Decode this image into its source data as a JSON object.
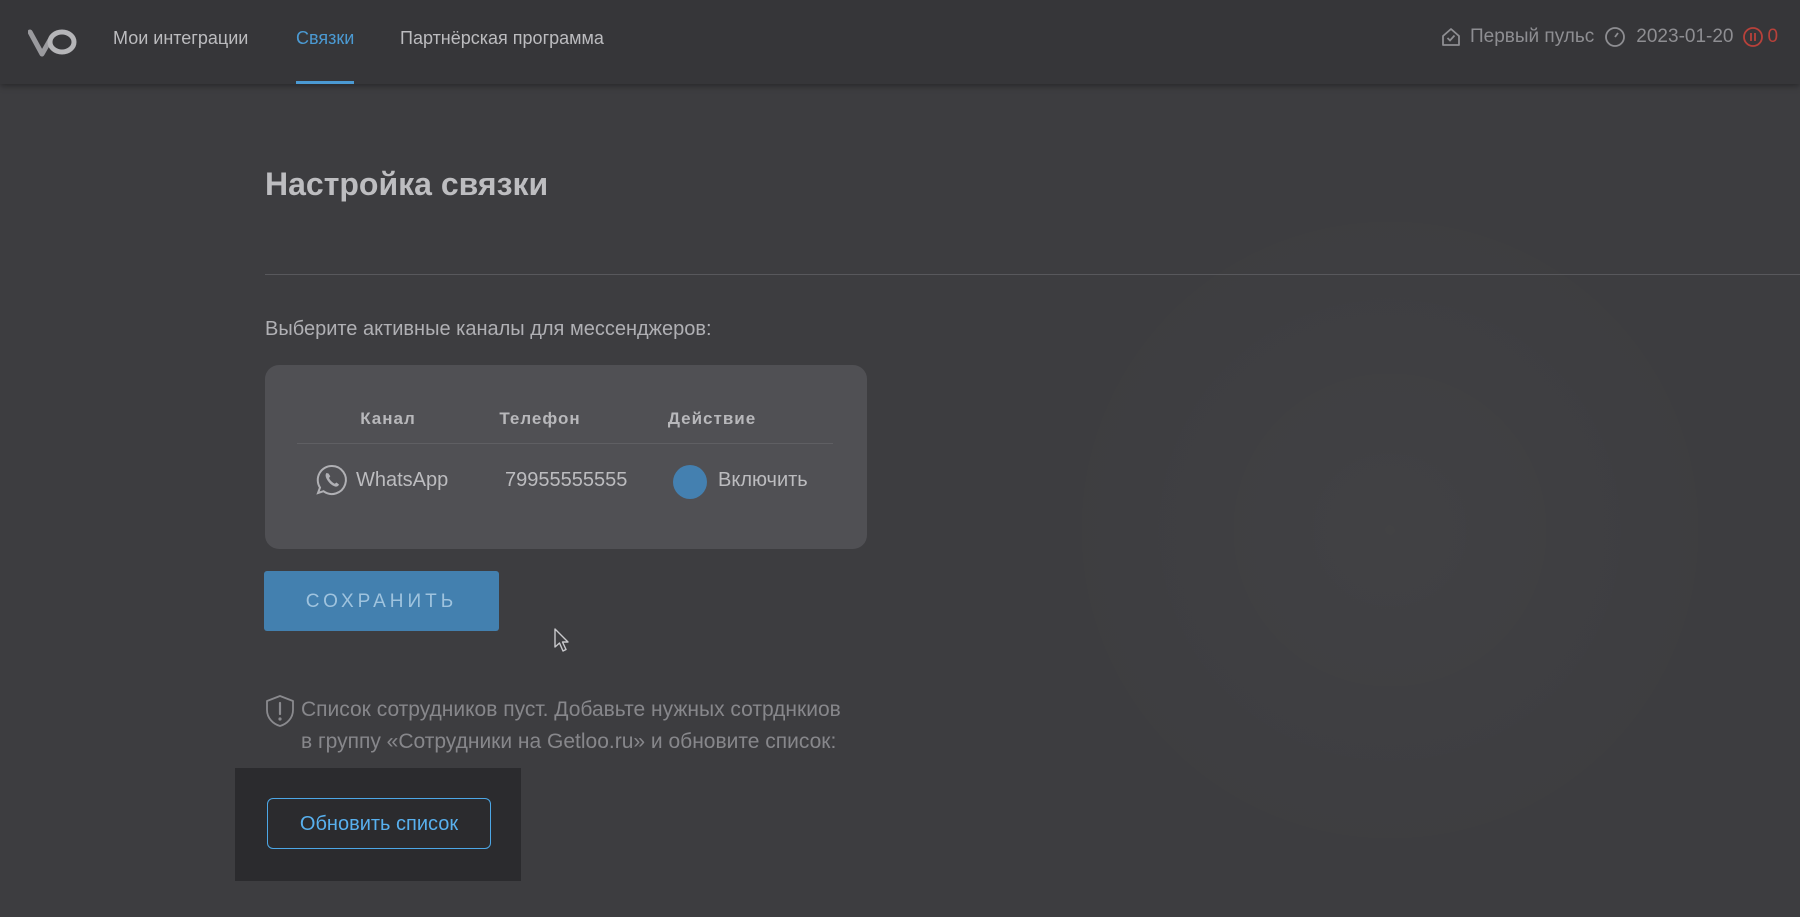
{
  "header": {
    "logo": "VO",
    "nav": [
      {
        "label": "Мои интеграции",
        "active": false
      },
      {
        "label": "Связки",
        "active": true
      },
      {
        "label": "Партнёрская программа",
        "active": false
      }
    ],
    "tariff": "Первый пульс",
    "date": "2023-01-20",
    "alerts_count": "0",
    "icons": {
      "tariff": "house-check-icon",
      "date": "clock-icon",
      "alerts": "power-alert-icon"
    }
  },
  "main": {
    "title": "Настройка связки",
    "channels_label": "Выберите активные каналы для мессенджеров:",
    "table": {
      "columns": [
        "Канал",
        "Телефон",
        "Действие"
      ],
      "rows": [
        {
          "channel": "WhatsApp",
          "phone": "79955555555",
          "action": "Включить",
          "enabled": false
        }
      ]
    },
    "save_label": "СОХРАНИТЬ",
    "notice_line1": "Список сотрудников пуст. Добавьте нужных сотрднкиов",
    "notice_line2": "в группу «Сотрудники на Getloo.ru» и обновите список:",
    "refresh_label": "Обновить список"
  },
  "colors": {
    "accent": "#4b9ad3",
    "alert": "#c0392b",
    "background": "#3d3d40"
  }
}
